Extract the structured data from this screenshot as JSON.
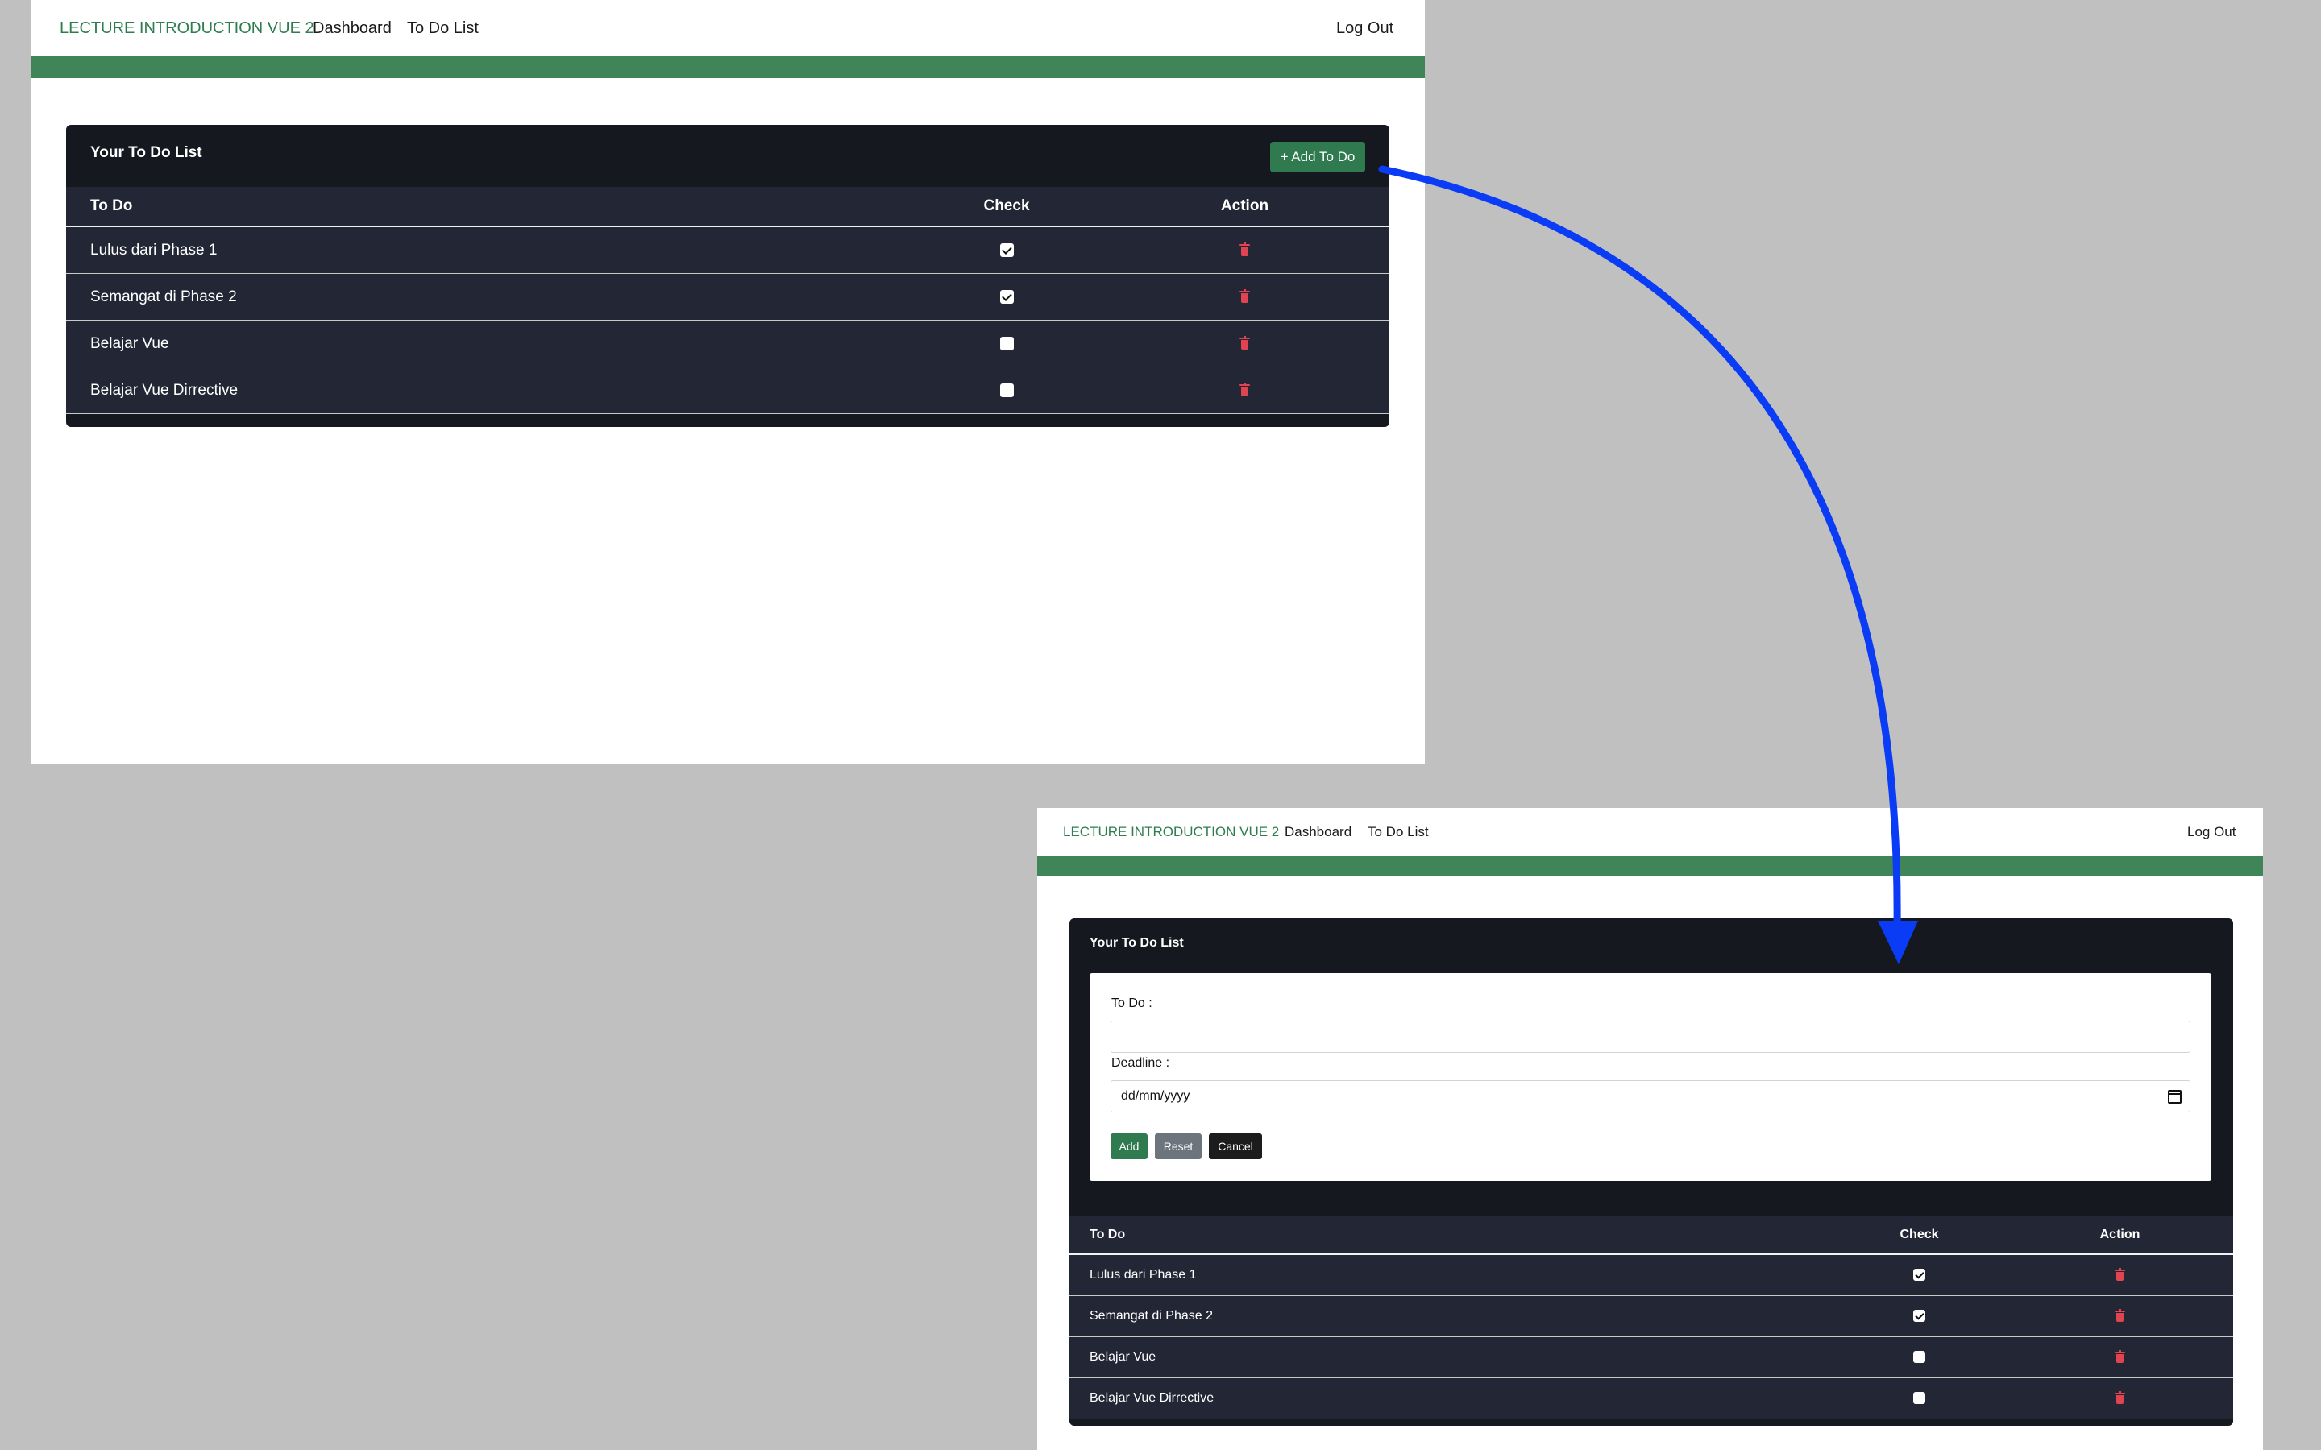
{
  "nav": {
    "brand": "LECTURE INTRODUCTION VUE 2",
    "dashboard": "Dashboard",
    "todo_list": "To Do List",
    "logout": "Log Out"
  },
  "card": {
    "title": "Your To Do List",
    "add_button": "+ Add To Do"
  },
  "table": {
    "headers": {
      "todo": "To Do",
      "check": "Check",
      "action": "Action"
    },
    "rows": [
      {
        "todo": "Lulus dari Phase 1",
        "checked": true
      },
      {
        "todo": "Semangat di Phase 2",
        "checked": true
      },
      {
        "todo": "Belajar Vue",
        "checked": false
      },
      {
        "todo": "Belajar Vue Dirrective",
        "checked": false
      }
    ]
  },
  "form": {
    "todo_label": "To Do :",
    "todo_value": "",
    "deadline_label": "Deadline :",
    "deadline_placeholder": "dd/mm/yyyy",
    "add_label": "Add",
    "reset_label": "Reset",
    "cancel_label": "Cancel"
  },
  "colors": {
    "background": "#c0c0c0",
    "brand": "#2e7d4f",
    "green_bar": "#3f8558",
    "card_dark": "#161820",
    "table_row": "#232634",
    "danger": "#e04450",
    "arrow": "#0b3cf5",
    "reset_button": "#6c757d"
  },
  "icons": {
    "trash": "trash-icon",
    "checkbox": "checkbox-icon",
    "calendar": "calendar-icon",
    "arrow": "transition-arrow"
  }
}
